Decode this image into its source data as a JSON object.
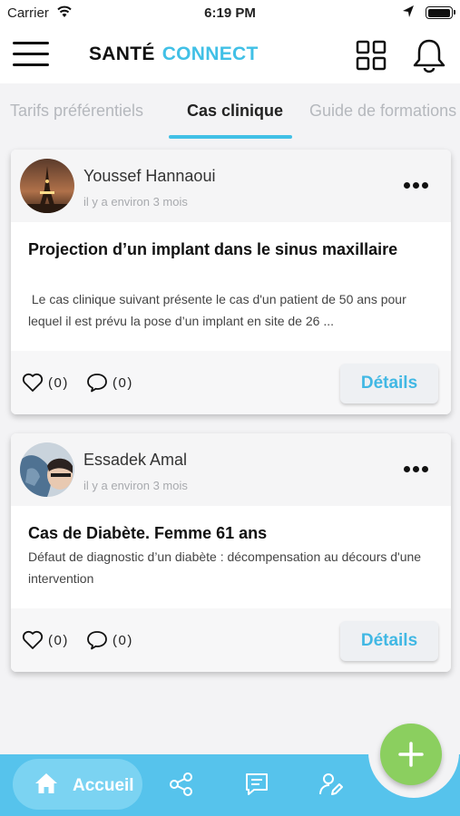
{
  "status_bar": {
    "carrier": "Carrier",
    "time": "6:19 PM"
  },
  "header": {
    "brand_part1": "SANTÉ",
    "brand_part2": "CONNECT"
  },
  "tabs": [
    {
      "label": "Tarifs préférentiels",
      "active": false
    },
    {
      "label": "Cas clinique",
      "active": true
    },
    {
      "label": "Guide de formations",
      "active": false
    }
  ],
  "posts": [
    {
      "author": "Youssef Hannaoui",
      "time_ago": "il y a environ 3 mois",
      "title": "Projection d’un implant dans le sinus maxillaire",
      "description": " Le cas clinique suivant présente le cas d'un patient de 50 ans pour lequel il est prévu la pose d’un implant en site de 26 ...",
      "likes": "(0)",
      "comments": "(0)",
      "details_label": "Détails"
    },
    {
      "author": "Essadek Amal",
      "time_ago": "il y a environ 3 mois",
      "title": "Cas de Diabète. Femme 61 ans",
      "description": "Défaut de diagnostic d’un diabète : décompensation au décours d'une intervention",
      "likes": "(0)",
      "comments": "(0)",
      "details_label": "Détails"
    }
  ],
  "bottom_nav": {
    "home_label": "Accueil"
  },
  "colors": {
    "accent": "#41c0e6",
    "nav": "#56c3ec",
    "fab": "#8bcf5f"
  }
}
